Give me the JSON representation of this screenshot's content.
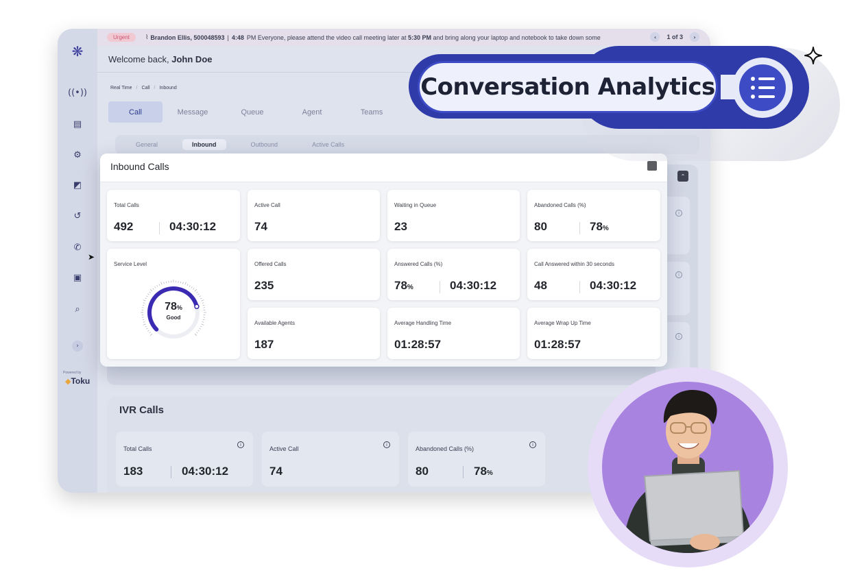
{
  "ticker": {
    "tag": "Urgent",
    "sender": "Brandon Ellis, 500048593",
    "separator": "|",
    "time": "4:48",
    "message_pre": "PM Everyone, please attend the video call meeting later at",
    "message_time": "5:30 PM",
    "message_post": "and bring along your laptop and notebook to take down some",
    "pager": "1 of 3"
  },
  "header": {
    "welcome_prefix": "Welcome back,",
    "user_name": "John Doe"
  },
  "breadcrumb": [
    "Real Time",
    "Call",
    "Inbound"
  ],
  "tabs": [
    "Call",
    "Message",
    "Queue",
    "Agent",
    "Teams"
  ],
  "subtabs": [
    "General",
    "Inbound",
    "Outbound",
    "Active Calls"
  ],
  "sidebar": {
    "powered_by": "Powered by",
    "brand": "Toku",
    "icons": [
      "brand-logo",
      "realtime-icon",
      "report-icon",
      "settings-icon",
      "contacts-icon",
      "history-icon",
      "phone-icon",
      "message-icon",
      "search-doc-icon"
    ]
  },
  "inbound": {
    "title": "Inbound Calls",
    "cards": {
      "total_calls": {
        "label": "Total Calls",
        "value": "492",
        "duration": "04:30:12"
      },
      "active_call": {
        "label": "Active Call",
        "value": "74"
      },
      "waiting": {
        "label": "Waiting in Queue",
        "value": "23"
      },
      "abandoned": {
        "label": "Abandoned Calls (%)",
        "value": "80",
        "percent": "78",
        "pct_sign": "%"
      },
      "service_level": {
        "label": "Service Level",
        "value": "78",
        "pct_sign": "%",
        "status": "Good",
        "level": 0.78
      },
      "offered": {
        "label": "Offered Calls",
        "value": "235"
      },
      "answered": {
        "label": "Answered Calls (%)",
        "percent": "78",
        "pct_sign": "%",
        "duration": "04:30:12"
      },
      "answered_30": {
        "label": "Call Answered within 30 seconds",
        "value": "48",
        "duration": "04:30:12"
      },
      "available_agents": {
        "label": "Available Agents",
        "value": "187"
      },
      "aht": {
        "label": "Average Handling Time",
        "value": "01:28:57"
      },
      "awut": {
        "label": "Average Wrap Up Time",
        "value": "01:28:57"
      }
    }
  },
  "ivr": {
    "title": "IVR Calls",
    "cards": {
      "total_calls": {
        "label": "Total Calls",
        "value": "183",
        "duration": "04:30:12"
      },
      "active_call": {
        "label": "Active Call",
        "value": "74"
      },
      "abandoned": {
        "label": "Abandoned Calls (%)",
        "value": "80",
        "percent": "78",
        "pct_sign": "%"
      }
    }
  },
  "badge": {
    "text": "Conversation Analytics",
    "icon": "list-icon"
  },
  "colors": {
    "brand_blue": "#3d4bc5",
    "gauge_purple": "#3b2bb3",
    "photo_bg": "#a983e0"
  }
}
